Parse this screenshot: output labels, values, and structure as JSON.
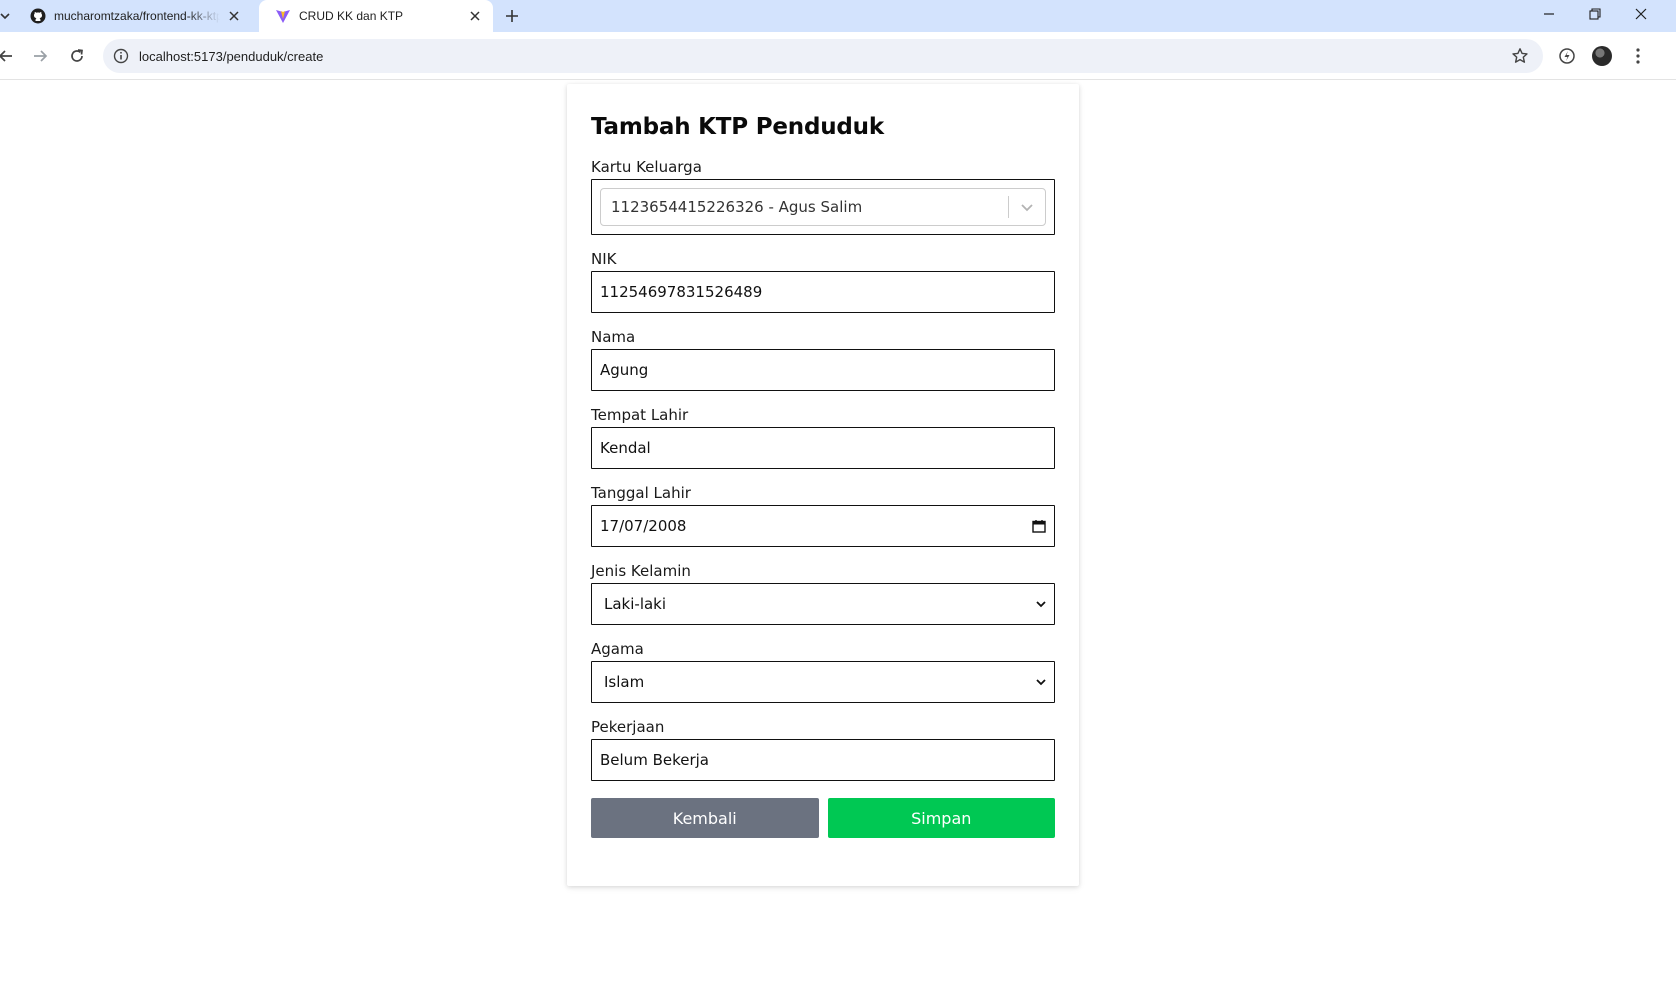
{
  "browser": {
    "tabs": [
      {
        "title": "mucharomtzaka/frontend-kk-ktp",
        "icon": "github-icon",
        "active": false
      },
      {
        "title": "CRUD KK dan KTP",
        "icon": "vite-icon",
        "active": true
      }
    ],
    "url": "localhost:5173/penduduk/create"
  },
  "form": {
    "title": "Tambah KTP Penduduk",
    "kartu_keluarga": {
      "label": "Kartu Keluarga",
      "value": "1123654415226326 - Agus Salim"
    },
    "nik": {
      "label": "NIK",
      "value": "11254697831526489"
    },
    "nama": {
      "label": "Nama",
      "value": "Agung"
    },
    "tempat_lahir": {
      "label": "Tempat Lahir",
      "value": "Kendal"
    },
    "tanggal_lahir": {
      "label": "Tanggal Lahir",
      "value": "17/07/2008"
    },
    "jenis_kelamin": {
      "label": "Jenis Kelamin",
      "value": "Laki-laki"
    },
    "agama": {
      "label": "Agama",
      "value": "Islam"
    },
    "pekerjaan": {
      "label": "Pekerjaan",
      "value": "Belum Bekerja"
    },
    "buttons": {
      "back": "Kembali",
      "save": "Simpan"
    }
  },
  "colors": {
    "tabbar": "#d3e3fd",
    "back_button": "#6b7280",
    "save_button": "#00c853"
  }
}
